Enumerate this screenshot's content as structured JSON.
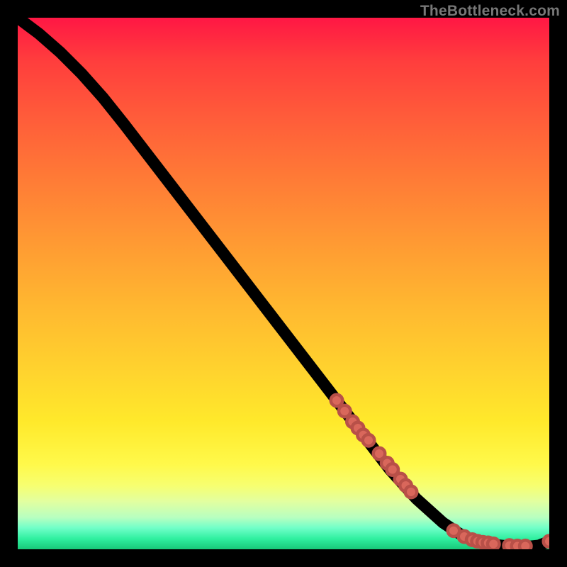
{
  "watermark": "TheBottleneck.com",
  "colors": {
    "dot_fill": "#d9675b",
    "dot_stroke": "#b85048",
    "curve_stroke": "#000000",
    "frame_bg": "#000000"
  },
  "chart_data": {
    "type": "line",
    "title": "",
    "xlabel": "",
    "ylabel": "",
    "xlim": [
      0,
      100
    ],
    "ylim": [
      0,
      100
    ],
    "grid": false,
    "legend": false,
    "series": [
      {
        "name": "bottleneck-curve",
        "x": [
          0,
          4,
          8,
          12,
          16,
          20,
          25,
          30,
          35,
          40,
          45,
          50,
          55,
          60,
          65,
          70,
          75,
          80,
          83,
          85,
          88,
          90,
          92,
          94,
          96,
          98,
          100
        ],
        "y": [
          100,
          97,
          93.5,
          89.5,
          85,
          80,
          73.5,
          67,
          60.5,
          54,
          47.5,
          41,
          34.5,
          28,
          21.5,
          15,
          9.5,
          5,
          3,
          2,
          1.2,
          0.8,
          0.6,
          0.5,
          0.5,
          0.7,
          1.5
        ]
      }
    ],
    "scatter_markers": {
      "name": "highlighted-points",
      "x": [
        60,
        61.5,
        63,
        64,
        65,
        66,
        68,
        69.5,
        70.5,
        72,
        73,
        74,
        82,
        84,
        85.5,
        86.5,
        87.5,
        88.5,
        89.5,
        92.5,
        94,
        95.5,
        100
      ],
      "y": [
        28,
        26,
        24,
        22.8,
        21.5,
        20.5,
        18,
        16.2,
        15,
        13.2,
        12,
        10.8,
        3.5,
        2.4,
        1.8,
        1.5,
        1.3,
        1.2,
        1.0,
        0.7,
        0.6,
        0.6,
        1.5
      ]
    }
  }
}
